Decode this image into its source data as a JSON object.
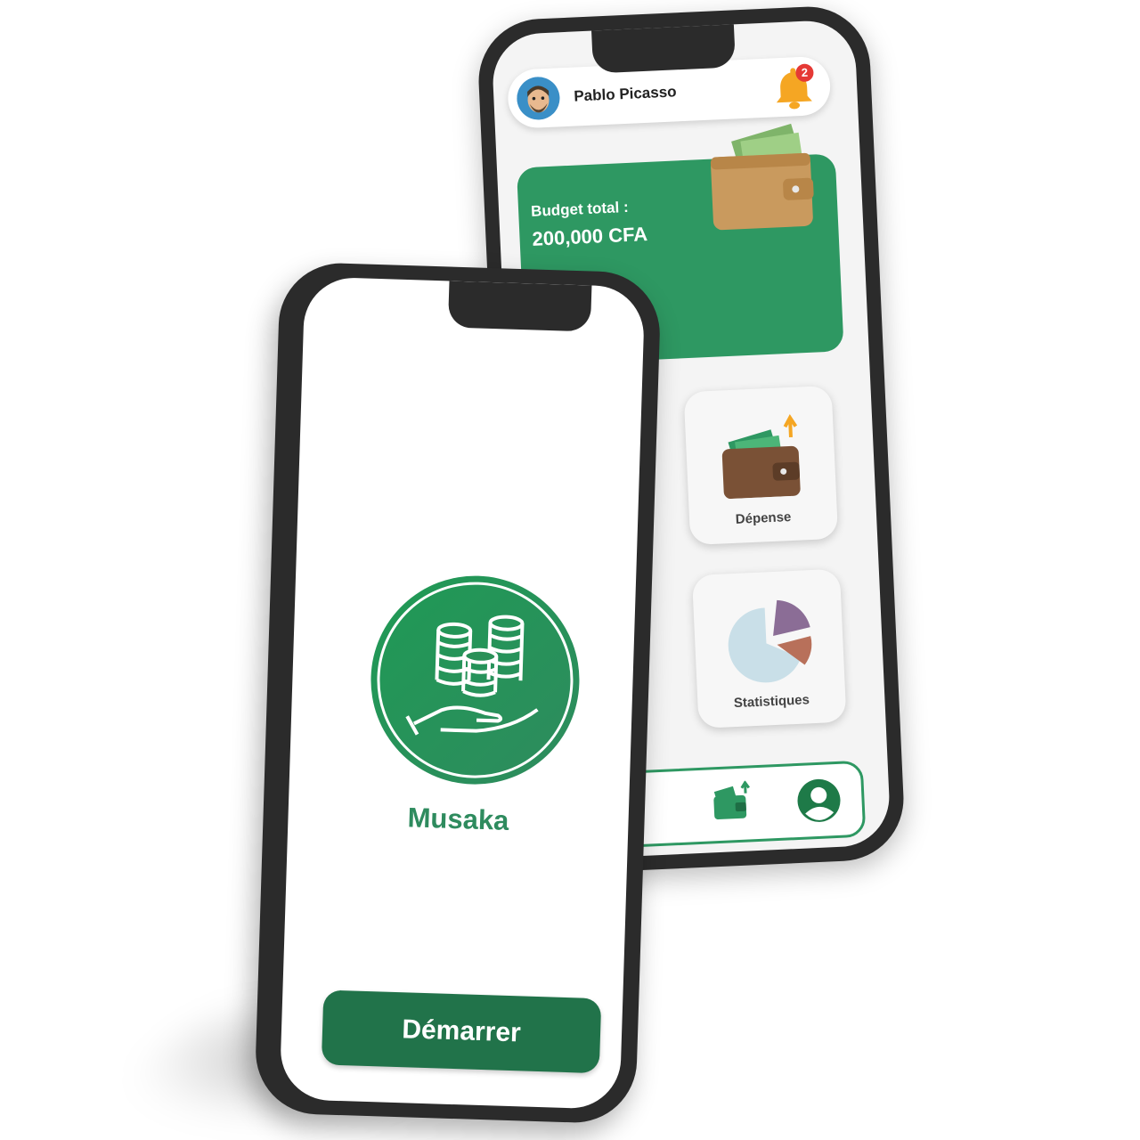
{
  "back_phone": {
    "header": {
      "user_name": "Pablo Picasso",
      "notification_count": "2"
    },
    "budget": {
      "label": "Budget total :",
      "value": "200,000 CFA"
    },
    "tiles": [
      {
        "label": "Dépense",
        "icon": "wallet-expense-icon"
      },
      {
        "label": "Statistiques",
        "icon": "pie-chart-icon"
      }
    ],
    "nav": {
      "items": [
        "wallet-icon",
        "profile-icon"
      ]
    }
  },
  "front_phone": {
    "app_name": "Musaka",
    "start_button": "Démarrer",
    "logo_icon": "coins-hand-icon"
  },
  "colors": {
    "brand_green": "#2e9862",
    "dark_green": "#21734a",
    "badge_red": "#e53935",
    "bell_yellow": "#f5a623"
  }
}
